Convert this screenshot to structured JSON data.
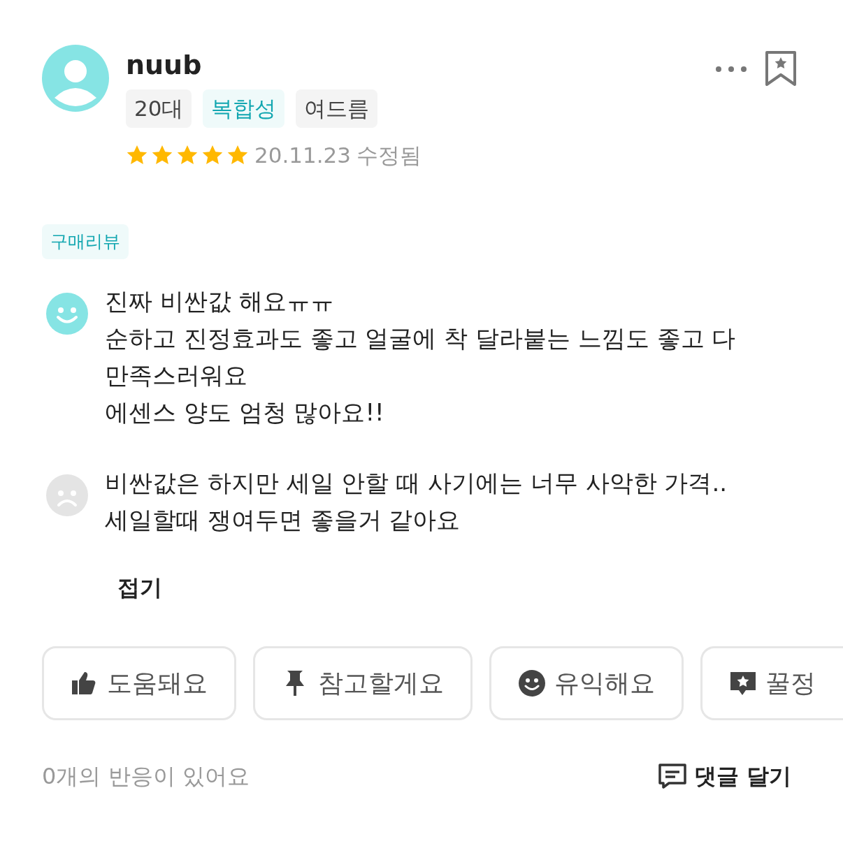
{
  "reviewer": {
    "name": "nuub",
    "tags": [
      {
        "label": "20대",
        "kind": "plain"
      },
      {
        "label": "복합성",
        "kind": "highlight"
      },
      {
        "label": "여드름",
        "kind": "plain"
      }
    ],
    "stars": 5,
    "date": "20.11.23",
    "edited_label": "수정됨"
  },
  "badge": "구매리뷰",
  "points": [
    {
      "kind": "good",
      "lines": [
        "진짜 비싼값 해요ㅠㅠ",
        "순하고 진정효과도 좋고 얼굴에 착 달라붙는 느낌도 좋고 다",
        "만족스러워요",
        "에센스 양도 엄청 많아요!!"
      ]
    },
    {
      "kind": "bad",
      "lines": [
        "비싼값은 하지만 세일 안할 때 사기에는 너무 사악한 가격..",
        "세일할때 쟁여두면 좋을거 같아요"
      ]
    }
  ],
  "collapse_label": "접기",
  "reactions": [
    {
      "kind": "thumb",
      "label": "도움돼요"
    },
    {
      "kind": "pin",
      "label": "참고할게요"
    },
    {
      "kind": "smile",
      "label": "유익해요"
    },
    {
      "kind": "tip",
      "label": "꿀정"
    }
  ],
  "reaction_count": "0개의 반응이 있어요",
  "comment_button": "댓글 달기"
}
